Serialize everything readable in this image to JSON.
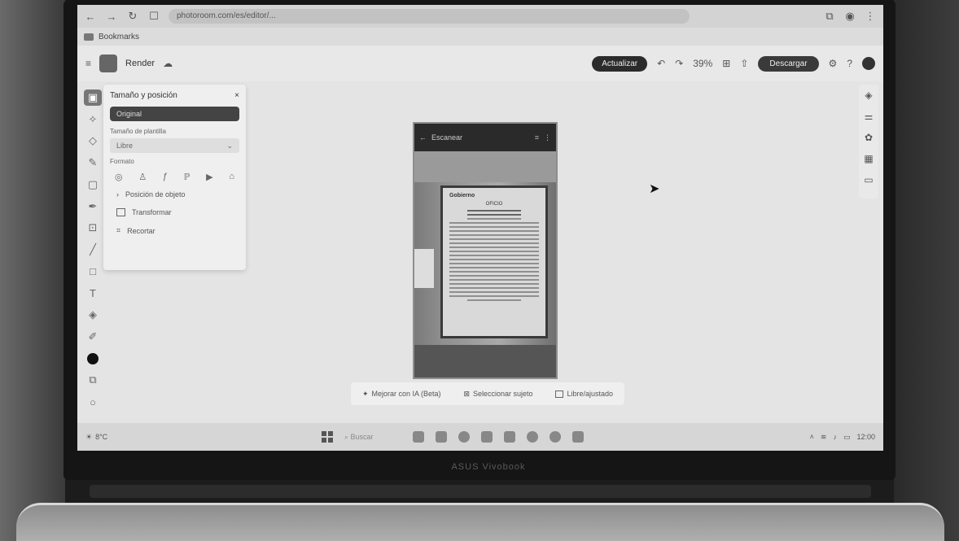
{
  "browser": {
    "url": "photoroom.com/es/editor/...",
    "bookmark_label": "Bookmarks"
  },
  "app": {
    "doc_title": "Render",
    "update_label": "Actualizar",
    "download_label": "Descargar",
    "zoom": "39%"
  },
  "panel": {
    "title": "Tamaño y posición",
    "active_tab": "Original",
    "size_label": "Tamaño de plantilla",
    "select_value": "Libre",
    "icons_label": "Formato",
    "rows": [
      {
        "label": "Posición de objeto"
      },
      {
        "label": "Transformar"
      },
      {
        "label": "Recortar"
      }
    ]
  },
  "phone": {
    "header_text": "Escanear"
  },
  "document": {
    "logo": "Gobierno",
    "heading": "OFICIO"
  },
  "actions": {
    "item1": "Mejorar con IA (Beta)",
    "item2": "Seleccionar sujeto",
    "item3": "Libre/ajustado"
  },
  "taskbar": {
    "weather": "8°C",
    "search": "Buscar",
    "time": "12:00"
  },
  "laptop": {
    "brand": "ASUS Vivobook"
  }
}
